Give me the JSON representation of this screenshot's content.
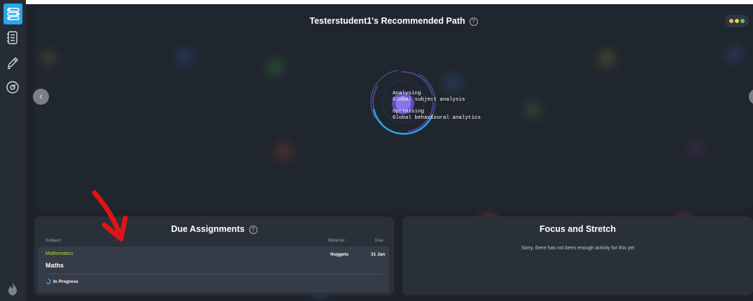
{
  "sidebar": {
    "items": [
      {
        "icon": "path-icon",
        "active": true
      },
      {
        "icon": "notebook-icon",
        "active": false
      },
      {
        "icon": "pencil-icon",
        "active": false
      },
      {
        "icon": "gauge-icon",
        "active": false
      },
      {
        "icon": "flame-icon",
        "active": false
      }
    ]
  },
  "header": {
    "title": "Testerstudent1's Recommended Path",
    "help_glyph": "?"
  },
  "status_dots": {
    "colors": [
      "#f2b84b",
      "#e8d43f",
      "#5cc85f"
    ]
  },
  "carousel": {
    "prev_glyph": "‹"
  },
  "loader": {
    "line1": "Analysing",
    "line2": "Global subject analysis",
    "line3": "Optimising",
    "line4": "Global behavioural analytics"
  },
  "due_assignments": {
    "title": "Due Assignments",
    "help_glyph": "?",
    "headers": {
      "subject": "Subject",
      "material": "Material",
      "due": "Due"
    },
    "rows": [
      {
        "subject": "Mathematics",
        "name": "Maths",
        "material": "Nuggets",
        "due": "31 Jan",
        "status": "In Progress"
      }
    ]
  },
  "focus_stretch": {
    "title": "Focus and Stretch",
    "message": "Sorry, there has not been enough activity for this yet"
  },
  "colors": {
    "accent": "#2aa6e8",
    "subject": "#b7d334",
    "sidebar": "#262c36",
    "background": "#1d222b"
  }
}
